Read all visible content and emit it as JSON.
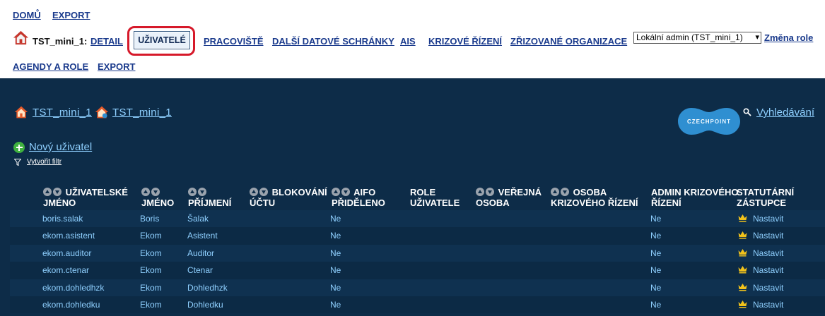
{
  "top_nav": {
    "home": "DOMŮ",
    "export": "EXPORT"
  },
  "org": {
    "label": "TST_mini_1:"
  },
  "tabs": {
    "detail": "DETAIL",
    "users": "UŽIVATELÉ",
    "workplaces": "PRACOVIŠTĚ",
    "other_boxes": "DALŠÍ DATOVÉ SCHRÁNKY",
    "ais": "AIS",
    "crisis": "KRIZOVÉ ŘÍZENÍ",
    "founded_orgs": "ZŘIZOVANÉ ORGANIZACE",
    "agendas_roles": "AGENDY A ROLE",
    "export": "EXPORT"
  },
  "role_select": {
    "value": "Lokální admin (TST_mini_1)",
    "change_label": "Změna role"
  },
  "breadcrumb": [
    "TST_mini_1",
    "TST_mini_1"
  ],
  "logo": {
    "word1": "CZECH",
    "word2": "POINT",
    "color": "#2f8fd1"
  },
  "search": {
    "label": "Vyhledávání"
  },
  "actions": {
    "new_user": "Nový uživatel",
    "create_filter": "Vytvořit filtr"
  },
  "columns": {
    "username": [
      "UŽIVATELSKÉ",
      "JMÉNO"
    ],
    "first_name": [
      "JMÉNO",
      ""
    ],
    "last_name": [
      "",
      "PŘÍJMENÍ"
    ],
    "account_blocking": [
      "BLOKOVÁNÍ",
      "ÚČTU"
    ],
    "aifo": [
      "AIFO",
      "PŘIDĚLENO"
    ],
    "user_role": [
      "ROLE",
      "UŽIVATELE"
    ],
    "public_person": [
      "VEŘEJNÁ",
      "OSOBA"
    ],
    "crisis_person": [
      "OSOBA",
      "KRIZOVÉHO ŘÍZENÍ"
    ],
    "crisis_admin": [
      "ADMIN KRIZOVÉHO",
      "ŘÍZENÍ"
    ],
    "statutory": [
      "STATUTÁRNÍ",
      "ZÁSTUPCE"
    ]
  },
  "rows": [
    {
      "username": "boris.salak",
      "first_name": "Boris",
      "last_name": "Šalak",
      "aifo": "Ne",
      "crisis_admin": "Ne",
      "statutory": "Nastavit"
    },
    {
      "username": "ekom.asistent",
      "first_name": "Ekom",
      "last_name": "Asistent",
      "aifo": "Ne",
      "crisis_admin": "Ne",
      "statutory": "Nastavit"
    },
    {
      "username": "ekom.auditor",
      "first_name": "Ekom",
      "last_name": "Auditor",
      "aifo": "Ne",
      "crisis_admin": "Ne",
      "statutory": "Nastavit"
    },
    {
      "username": "ekom.ctenar",
      "first_name": "Ekom",
      "last_name": "Ctenar",
      "aifo": "Ne",
      "crisis_admin": "Ne",
      "statutory": "Nastavit"
    },
    {
      "username": "ekom.dohledhzk",
      "first_name": "Ekom",
      "last_name": "Dohledhzk",
      "aifo": "Ne",
      "crisis_admin": "Ne",
      "statutory": "Nastavit"
    },
    {
      "username": "ekom.dohledku",
      "first_name": "Ekom",
      "last_name": "Dohledku",
      "aifo": "Ne",
      "crisis_admin": "Ne",
      "statutory": "Nastavit"
    }
  ],
  "colors": {
    "top_link": "#1a3a8c",
    "panel_bg": "#0d2c48",
    "link_light": "#8fd0ff",
    "highlight": "#d6192a",
    "crown": "#f2c21b"
  },
  "icons": [
    "house-icon",
    "search-icon",
    "plus-icon",
    "filter-icon",
    "crown-icon",
    "sort-up-icon",
    "sort-down-icon",
    "chevron-down-icon"
  ]
}
